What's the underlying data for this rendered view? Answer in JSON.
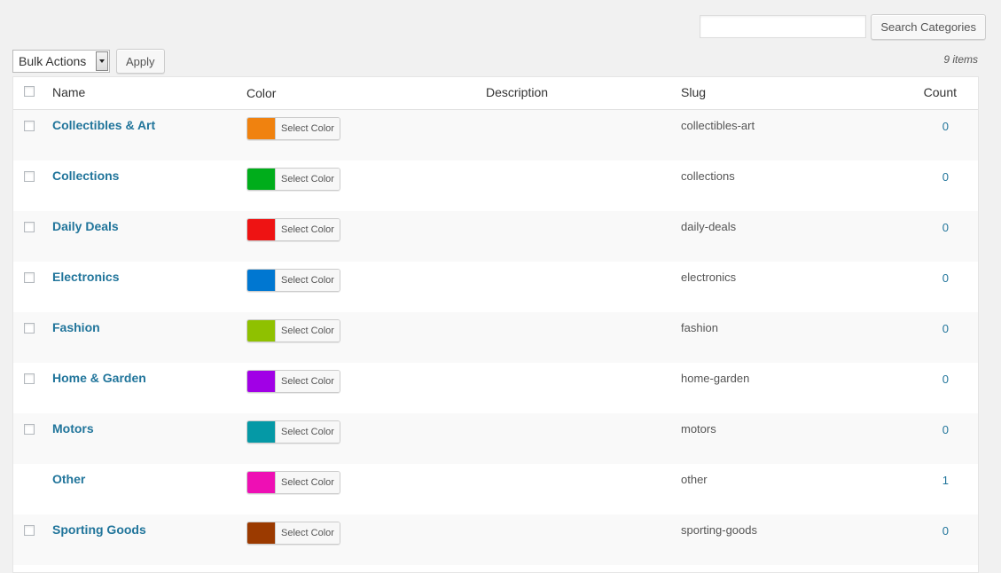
{
  "search": {
    "placeholder": "",
    "button_label": "Search Categories"
  },
  "bulk": {
    "selected": "Bulk Actions",
    "apply_label": "Apply"
  },
  "items_count": "9 items",
  "columns": {
    "name": "Name",
    "color": "Color",
    "description": "Description",
    "slug": "Slug",
    "count": "Count"
  },
  "select_color_label": "Select Color",
  "rows": [
    {
      "name": "Collectibles & Art",
      "color": "#f0820f",
      "slug": "collectibles-art",
      "count": "0",
      "checkbox": true
    },
    {
      "name": "Collections",
      "color": "#00ad1b",
      "slug": "collections",
      "count": "0",
      "checkbox": true
    },
    {
      "name": "Daily Deals",
      "color": "#ee1313",
      "slug": "daily-deals",
      "count": "0",
      "checkbox": true
    },
    {
      "name": "Electronics",
      "color": "#0077d1",
      "slug": "electronics",
      "count": "0",
      "checkbox": true
    },
    {
      "name": "Fashion",
      "color": "#8fc100",
      "slug": "fashion",
      "count": "0",
      "checkbox": true
    },
    {
      "name": "Home & Garden",
      "color": "#a100e6",
      "slug": "home-garden",
      "count": "0",
      "checkbox": true
    },
    {
      "name": "Motors",
      "color": "#0599a6",
      "slug": "motors",
      "count": "0",
      "checkbox": true
    },
    {
      "name": "Other",
      "color": "#ee0fb4",
      "slug": "other",
      "count": "1",
      "checkbox": false
    },
    {
      "name": "Sporting Goods",
      "color": "#9b3a00",
      "slug": "sporting-goods",
      "count": "0",
      "checkbox": true
    }
  ]
}
